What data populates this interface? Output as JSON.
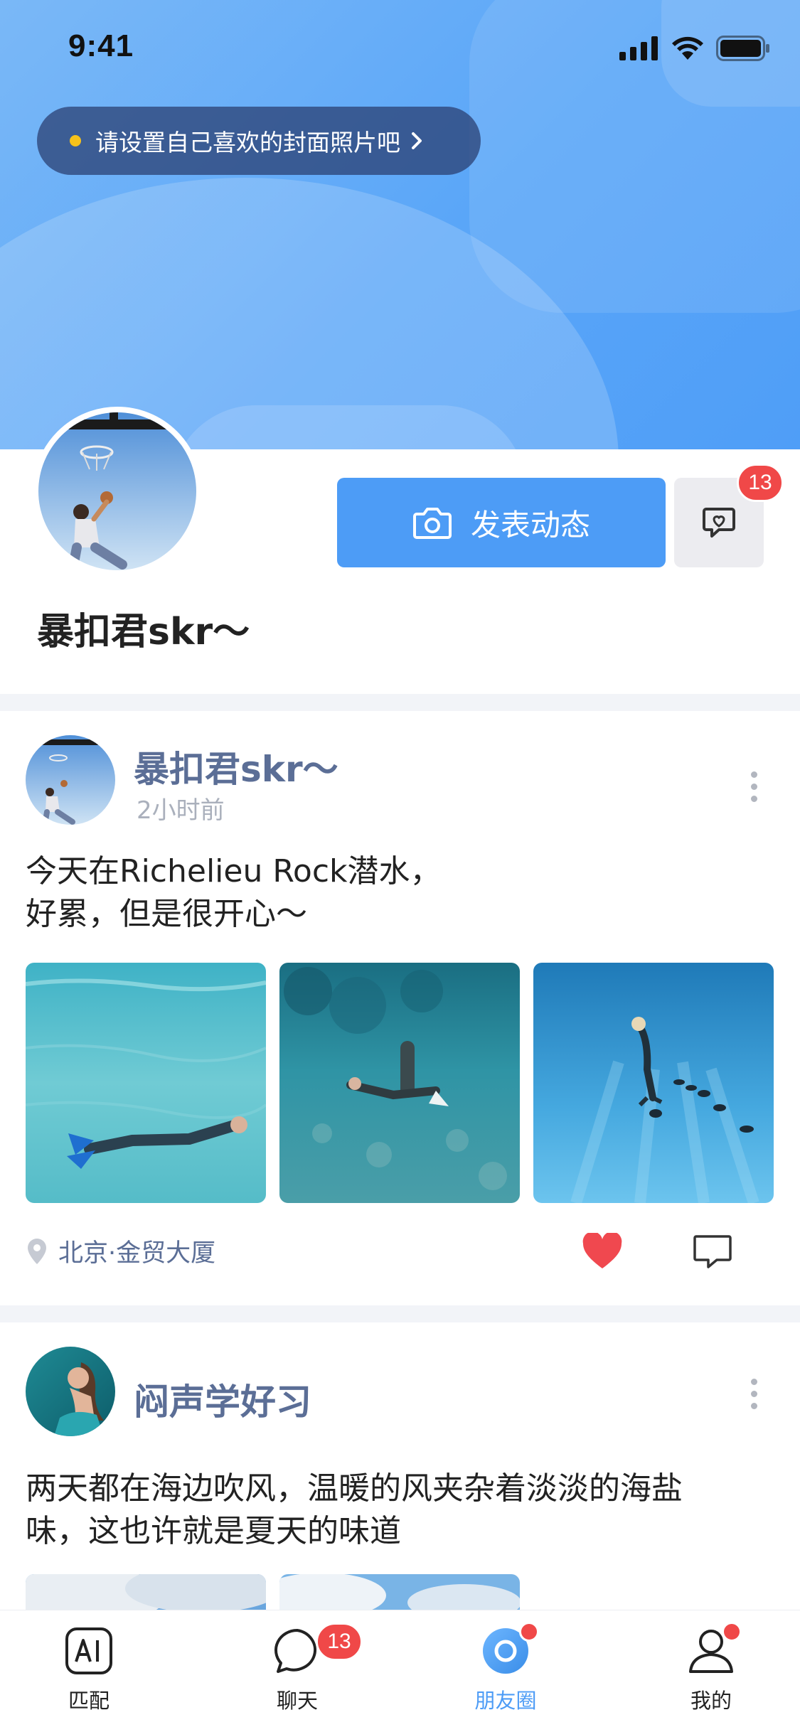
{
  "status_bar": {
    "time": "9:41"
  },
  "cover": {
    "tip_text": "请设置自己喜欢的封面照片吧"
  },
  "profile": {
    "name": "暴扣君skr～",
    "post_button_label": "发表动态",
    "message_badge": "13"
  },
  "feed": [
    {
      "author": "暴扣君skr～",
      "time": "2小时前",
      "content_line1": "今天在Richelieu Rock潜水，",
      "content_line2": "好累，但是很开心～",
      "location": "北京·金贸大厦",
      "liked": true
    },
    {
      "author": "闷声学好习",
      "content_line1": "两天都在海边吹风，温暖的风夹杂着淡淡的海盐",
      "content_line2": "味，这也许就是夏天的味道"
    }
  ],
  "tabbar": {
    "items": [
      {
        "label": "匹配",
        "icon": "ai-icon"
      },
      {
        "label": "聊天",
        "icon": "chat-icon",
        "badge": "13"
      },
      {
        "label": "朋友圈",
        "icon": "moments-icon",
        "active": true
      },
      {
        "label": "我的",
        "icon": "profile-icon"
      }
    ]
  },
  "colors": {
    "accent": "#4d9cf6",
    "author": "#5b6e96",
    "badge": "#f04848",
    "like": "#f0484f"
  }
}
